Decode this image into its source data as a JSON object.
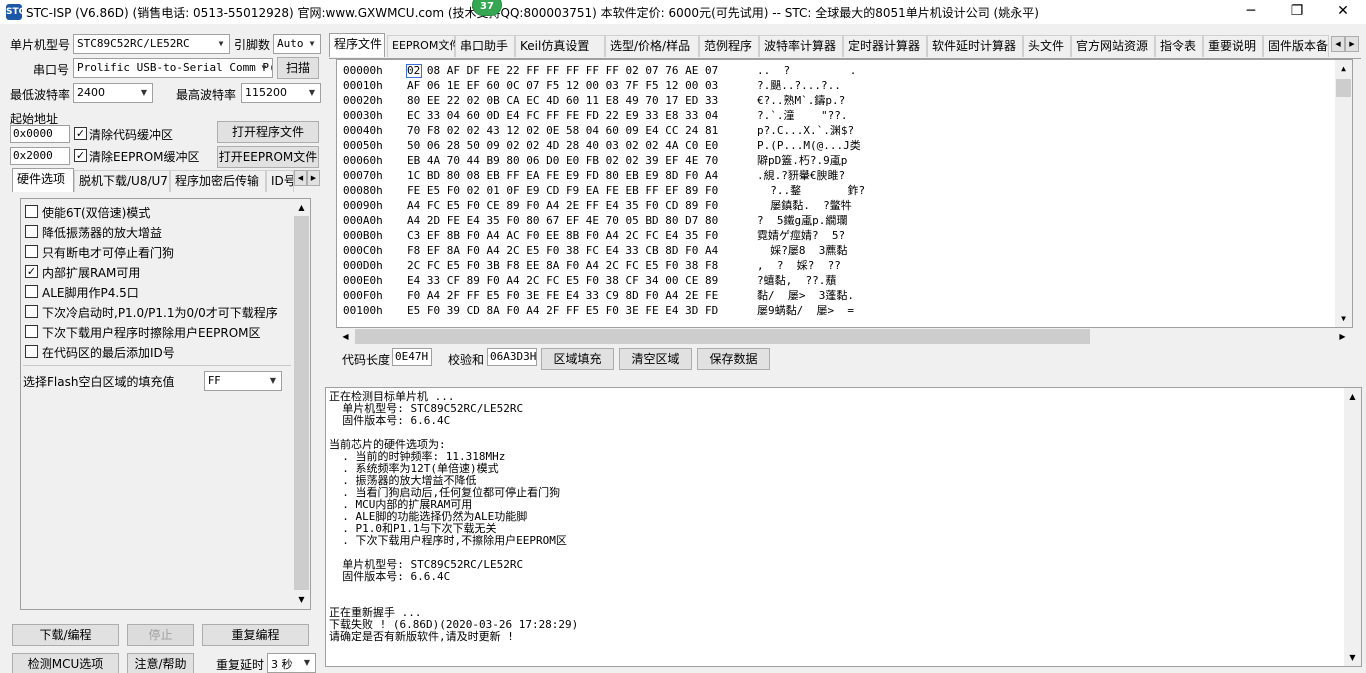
{
  "window": {
    "title": "STC-ISP (V6.86D) (销售电话: 0513-55012928) 官网:www.GXWMCU.com   (技术支持QQ:800003751) 本软件定价: 6000元(可先试用) -- STC: 全球最大的8051单片机设计公司 (姚永平)",
    "badge": "37",
    "app_icon": "STC"
  },
  "icons": {
    "minimize": "─",
    "restore": "❐",
    "close": "✕",
    "dropdown": "▼",
    "scroll_up": "▲",
    "scroll_down": "▼",
    "scroll_left": "◀",
    "scroll_right": "▶",
    "check": "✓"
  },
  "left": {
    "mcu_type_label": "单片机型号",
    "mcu_type_value": "STC89C52RC/LE52RC",
    "pin_count_label": "引脚数",
    "pin_count_value": "Auto",
    "port_label": "串口号",
    "port_value": "Prolific USB-to-Serial Comm P(",
    "scan_button": "扫描",
    "min_baud_label": "最低波特率",
    "min_baud_value": "2400",
    "max_baud_label": "最高波特率",
    "max_baud_value": "115200",
    "start_addr_label": "起始地址",
    "code_addr": "0x0000",
    "clear_code_label": "清除代码缓冲区",
    "open_prog_button": "打开程序文件",
    "eeprom_addr": "0x2000",
    "clear_eeprom_label": "清除EEPROM缓冲区",
    "open_eeprom_button": "打开EEPROM文件",
    "tabs": [
      "硬件选项",
      "脱机下载/U8/U7",
      "程序加密后传输",
      "ID号"
    ],
    "options": [
      {
        "label": "使能6T(双倍速)模式",
        "checked": false
      },
      {
        "label": "降低振荡器的放大增益",
        "checked": false
      },
      {
        "label": "只有断电才可停止看门狗",
        "checked": false
      },
      {
        "label": "内部扩展RAM可用",
        "checked": true
      },
      {
        "label": "ALE脚用作P4.5口",
        "checked": false
      },
      {
        "label": "下次冷启动时,P1.0/P1.1为0/0才可下载程序",
        "checked": false
      },
      {
        "label": "下次下载用户程序时擦除用户EEPROM区",
        "checked": false
      },
      {
        "label": "在代码区的最后添加ID号",
        "checked": false
      }
    ],
    "fill_label": "选择Flash空白区域的填充值",
    "fill_value": "FF",
    "download_button": "下载/编程",
    "stop_button": "停止",
    "reprogram_button": "重复编程",
    "detect_button": "检测MCU选项",
    "help_button": "注意/帮助",
    "repeat_delay_label": "重复延时",
    "repeat_delay_value": "3 秒"
  },
  "right": {
    "tabs": [
      "程序文件",
      "EEPROM文件",
      "串口助手",
      "Keil仿真设置",
      "选型/价格/样品",
      "范例程序",
      "波特率计算器",
      "定时器计算器",
      "软件延时计算器",
      "头文件",
      "官方网站资源",
      "指令表",
      "重要说明",
      "固件版本备"
    ],
    "hex_rows": [
      {
        "addr": "00000h",
        "bytes": "02 08 AF DF FE 22 FF FF FF FF FF 02 07 76 AE 07",
        "ascii": "..  ?         ."
      },
      {
        "addr": "00010h",
        "bytes": "AF 06 1E EF 60 0C 07 F5 12 00 03 7F F5 12 00 03",
        "ascii": "?.颶..?...?.."
      },
      {
        "addr": "00020h",
        "bytes": "80 EE 22 02 0B CA EC 4D 60 11 E8 49 70 17 ED 33",
        "ascii": "€?..熟M`.鑄p.?"
      },
      {
        "addr": "00030h",
        "bytes": "EC 33 04 60 0D E4 FC FF FE FD 22 E9 33 E8 33 04",
        "ascii": "?.`.潼    \"??."
      },
      {
        "addr": "00040h",
        "bytes": "70 F8 02 02 43 12 02 0E 58 04 60 09 E4 CC 24 81",
        "ascii": "p?.C...X.`.渊$?"
      },
      {
        "addr": "00050h",
        "bytes": "50 06 28 50 09 02 02 4D 28 40 03 02 02 4A C0 E0",
        "ascii": "P.(P...M(@...J类"
      },
      {
        "addr": "00060h",
        "bytes": "EB 4A 70 44 B9 80 06 D0 E0 FB 02 02 39 EF 4E 70",
        "ascii": "隦pD篕.朽?.9颪p"
      },
      {
        "addr": "00070h",
        "bytes": "1C BD 80 08 EB FF EA FE E9 FD 80 EB E9 8D F0 A4",
        "ascii": ".絸.?豜轝€腴雎?"
      },
      {
        "addr": "00080h",
        "bytes": "FE E5 F0 02 01 0F E9 CD F9 EA FE EB FF EF 89 F0",
        "ascii": "  ?..鍪       鈼?"
      },
      {
        "addr": "00090h",
        "bytes": "A4 FC E5 F0 CE 89 F0 A4 2E FF E4 35 F0 CD 89 F0",
        "ascii": "  屡鎮黏.  ?鳖牪"
      },
      {
        "addr": "000A0h",
        "bytes": "A4 2D FE E4 35 F0 80 67 EF 4E 70 05 BD 80 D7 80",
        "ascii": "?  5鐵g颪p.繝瓓"
      },
      {
        "addr": "000B0h",
        "bytes": "C3 EF 8B F0 A4 AC F0 EE 8B F0 A4 2C FC E4 35 F0",
        "ascii": "霓婧ゲ痙婧?  5?"
      },
      {
        "addr": "000C0h",
        "bytes": "F8 EF 8A F0 A4 2C E5 F0 38 FC E4 33 CB 8D F0 A4",
        "ascii": "  婇?屡8  3藨黏"
      },
      {
        "addr": "000D0h",
        "bytes": "2C FC E5 F0 3B F8 EE 8A F0 A4 2C FC E5 F0 38 F8",
        "ascii": ",  ?  婇?  ??"
      },
      {
        "addr": "000E0h",
        "bytes": "E4 33 CF 89 F0 A4 2C FC E5 F0 38 CF 34 00 CE 89",
        "ascii": "?蟢黏,  ??.蘈"
      },
      {
        "addr": "000F0h",
        "bytes": "F0 A4 2F FF E5 F0 3E FE E4 33 C9 8D F0 A4 2E FE",
        "ascii": "黏/  屡>  3蓬黏."
      },
      {
        "addr": "00100h",
        "bytes": "E5 F0 39 CD 8A F0 A4 2F FF E5 F0 3E FE E4 3D FD",
        "ascii": "屡9蜹黏/  屡>  ="
      }
    ],
    "code_len_label": "代码长度",
    "code_len_value": "0E47H",
    "checksum_label": "校验和",
    "checksum_value": "06A3D3H",
    "fill_region_button": "区域填充",
    "clear_region_button": "清空区域",
    "save_data_button": "保存数据"
  },
  "log": [
    "正在检测目标单片机 ...",
    "  单片机型号: STC89C52RC/LE52RC",
    "  固件版本号: 6.6.4C",
    "",
    "当前芯片的硬件选项为:",
    "  . 当前的时钟频率: 11.318MHz",
    "  . 系统频率为12T(单倍速)模式",
    "  . 振荡器的放大增益不降低",
    "  . 当看门狗启动后,任何复位都可停止看门狗",
    "  . MCU内部的扩展RAM可用",
    "  . ALE脚的功能选择仍然为ALE功能脚",
    "  . P1.0和P1.1与下次下载无关",
    "  . 下次下载用户程序时,不擦除用户EEPROM区",
    "",
    "  单片机型号: STC89C52RC/LE52RC",
    "  固件版本号: 6.6.4C",
    "",
    "",
    "正在重新握手 ...",
    "下载失败 ! (6.86D)(2020-03-26 17:28:29)",
    "请确定是否有新版软件,请及时更新 !"
  ]
}
